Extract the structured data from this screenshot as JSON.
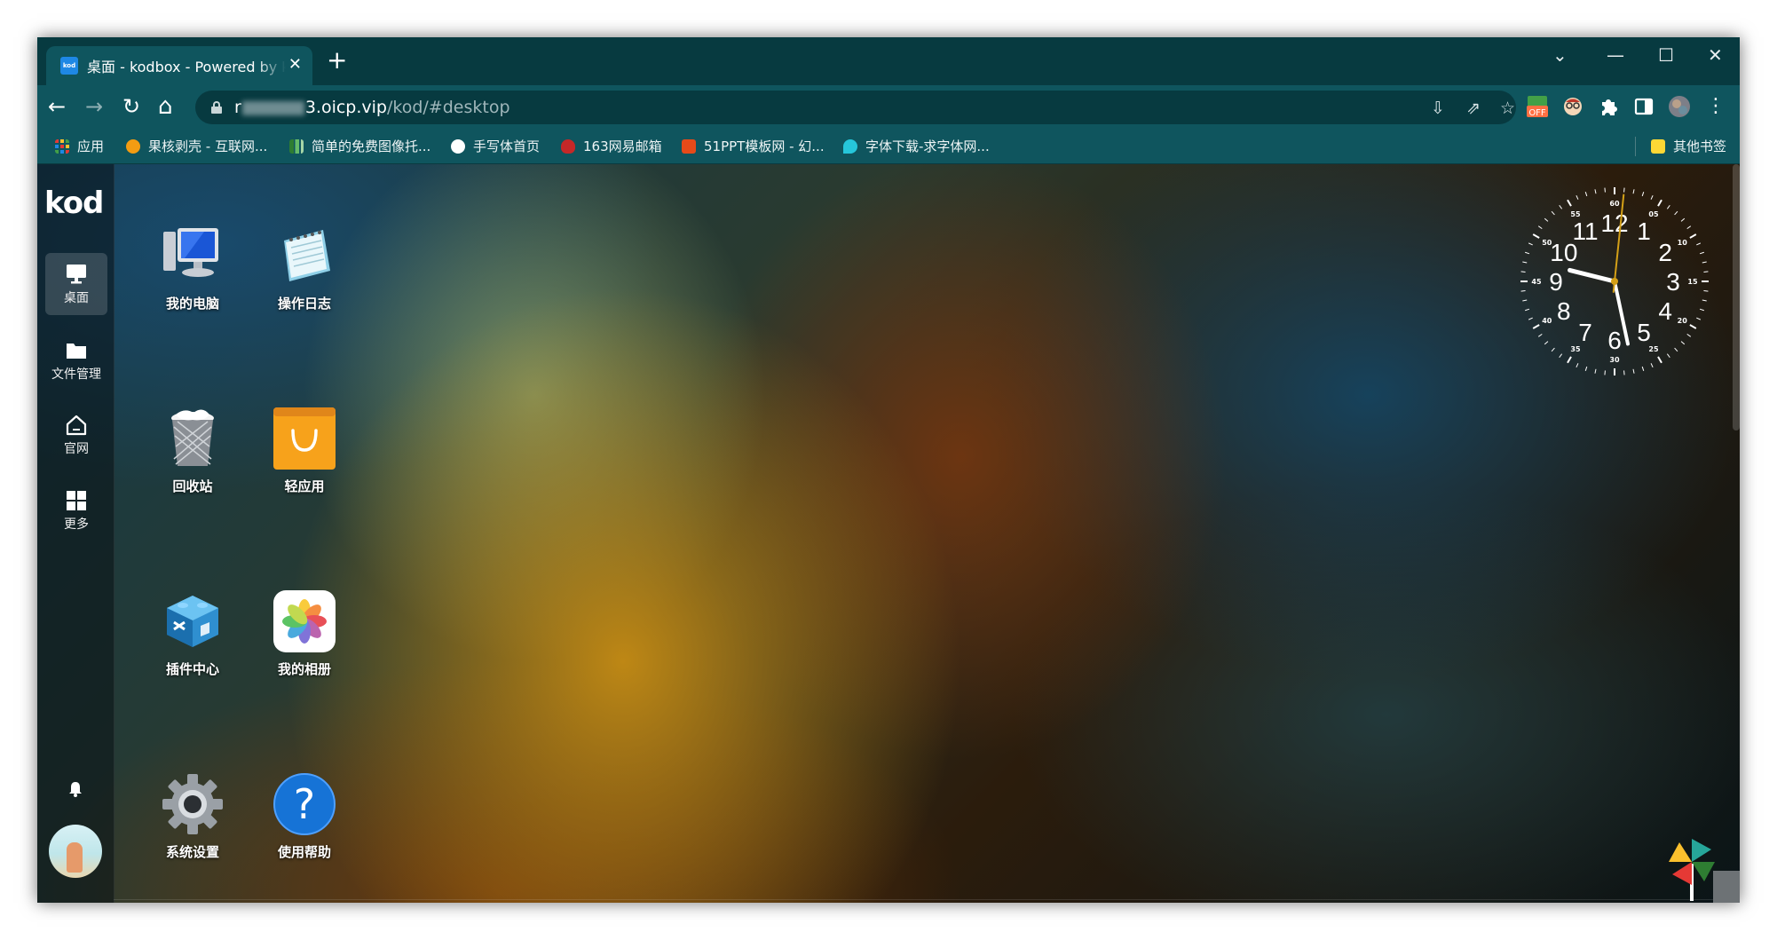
{
  "browser": {
    "tab": {
      "favicon_text": "kod",
      "title": "桌面 - kodbox - Powered by kodcloud",
      "close": "✕"
    },
    "new_tab": "+",
    "window_controls": {
      "menu": "⌄",
      "minimize": "—",
      "maximize": "☐",
      "close": "✕"
    },
    "nav": {
      "back": "←",
      "forward": "→",
      "reload": "↻",
      "home": "⌂"
    },
    "address": {
      "host_start": "r",
      "host_end": "3.oicp.vip",
      "path": "/kod/#desktop"
    },
    "extension_badge": "OFF",
    "menu_dots": "⋮"
  },
  "bookmarks": {
    "items": [
      {
        "label": "应用",
        "color": "#e53935"
      },
      {
        "label": "果核剥壳 - 互联网...",
        "color": "#f39c12"
      },
      {
        "label": "简单的免费图像托...",
        "color": "#4caf50"
      },
      {
        "label": "手写体首页",
        "color": "#ffffff"
      },
      {
        "label": "163网易邮箱",
        "color": "#d32f2f"
      },
      {
        "label": "51PPT模板网 - 幻...",
        "color": "#e64a19"
      },
      {
        "label": "字体下载-求字体网...",
        "color": "#26c6da"
      }
    ],
    "other": "其他书签"
  },
  "app": {
    "logo": "kod",
    "sidebar": [
      {
        "label": "桌面",
        "icon": "monitor-icon",
        "active": true
      },
      {
        "label": "文件管理",
        "icon": "folder-icon",
        "active": false
      },
      {
        "label": "官网",
        "icon": "home-icon",
        "active": false
      },
      {
        "label": "更多",
        "icon": "grid-icon",
        "active": false
      }
    ],
    "desktop_icons": [
      {
        "label": "我的电脑",
        "icon": "computer-icon"
      },
      {
        "label": "操作日志",
        "icon": "notepad-icon"
      },
      {
        "label": "回收站",
        "icon": "recycle-bin-icon"
      },
      {
        "label": "轻应用",
        "icon": "shopping-bag-icon"
      },
      {
        "label": "插件中心",
        "icon": "plugin-cube-icon"
      },
      {
        "label": "我的相册",
        "icon": "photos-icon"
      },
      {
        "label": "系统设置",
        "icon": "gear-icon"
      },
      {
        "label": "使用帮助",
        "icon": "help-icon"
      }
    ],
    "clock": {
      "hour_numerals": [
        "12",
        "1",
        "2",
        "3",
        "4",
        "5",
        "6",
        "7",
        "8",
        "9",
        "10",
        "11"
      ],
      "minute_numerals": [
        "60",
        "05",
        "10",
        "15",
        "20",
        "25",
        "30",
        "35",
        "40",
        "45",
        "50",
        "55"
      ],
      "time": {
        "hours": 9,
        "minutes": 28,
        "seconds": 1
      }
    }
  }
}
